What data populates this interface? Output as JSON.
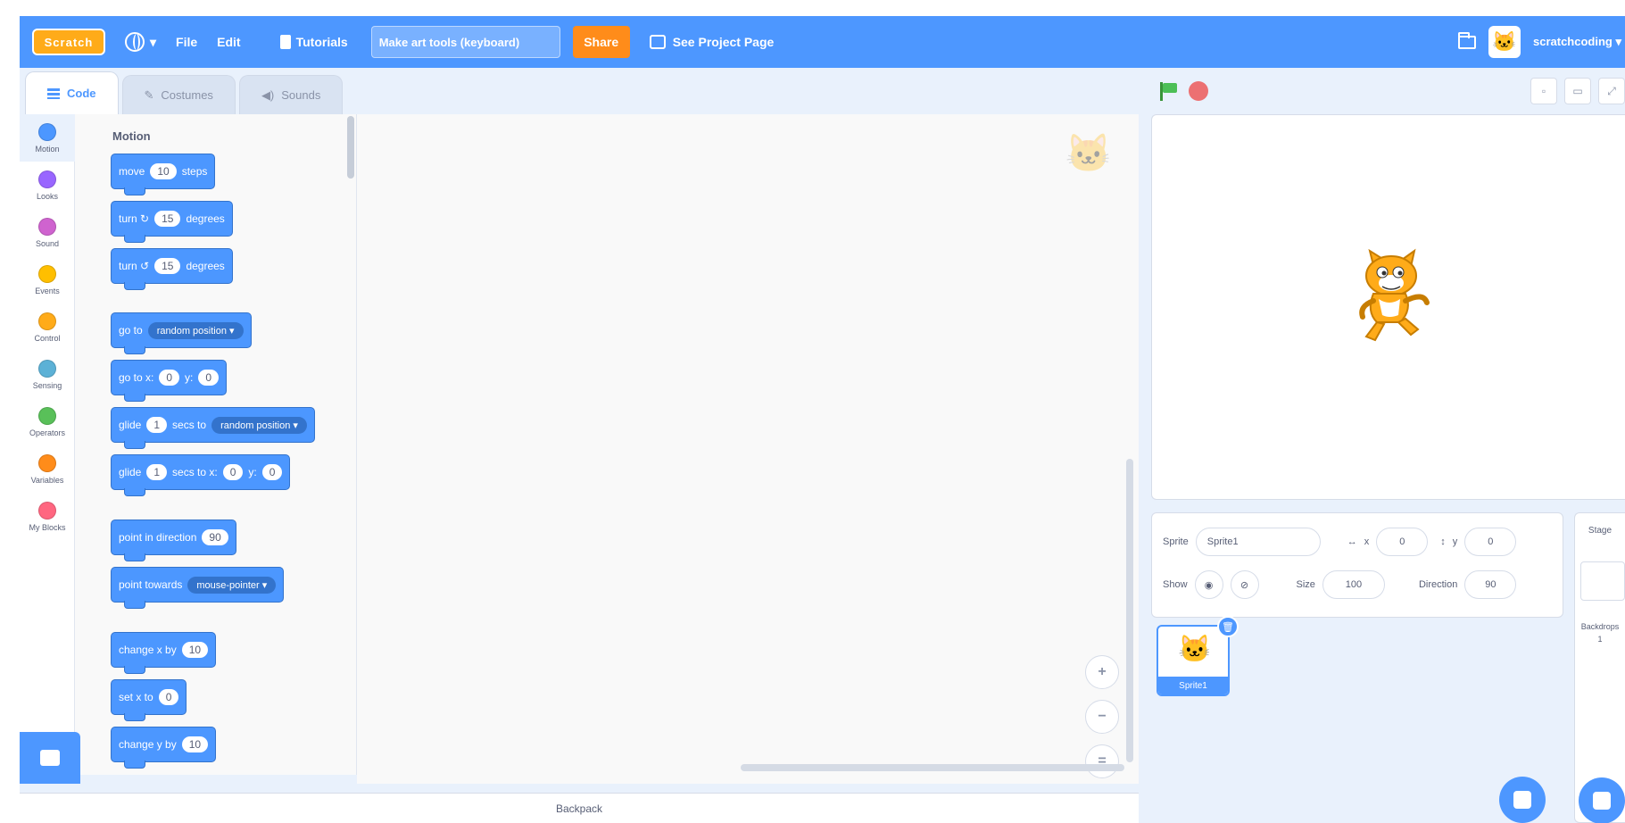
{
  "menubar": {
    "logo": "Scratch",
    "language_icon": "globe-icon",
    "file": "File",
    "edit": "Edit",
    "tutorials": "Tutorials",
    "project_title": "Make art tools (keyboard)",
    "share": "Share",
    "see_project_page": "See Project Page",
    "username": "scratchcoding"
  },
  "tabs": [
    {
      "label": "Code",
      "icon": "code-icon"
    },
    {
      "label": "Costumes",
      "icon": "brush-icon"
    },
    {
      "label": "Sounds",
      "icon": "speaker-icon"
    }
  ],
  "categories": [
    {
      "label": "Motion",
      "color": "#4c97ff"
    },
    {
      "label": "Looks",
      "color": "#9966ff"
    },
    {
      "label": "Sound",
      "color": "#cf63cf"
    },
    {
      "label": "Events",
      "color": "#ffbf00"
    },
    {
      "label": "Control",
      "color": "#ffab19"
    },
    {
      "label": "Sensing",
      "color": "#5cb1d6"
    },
    {
      "label": "Operators",
      "color": "#59c059"
    },
    {
      "label": "Variables",
      "color": "#ff8c1a"
    },
    {
      "label": "My Blocks",
      "color": "#ff6680"
    }
  ],
  "palette": {
    "title": "Motion",
    "blocks": {
      "move": {
        "text": "move",
        "value": "10",
        "suffix": "steps"
      },
      "turn_right": {
        "text": "turn ↻",
        "value": "15",
        "suffix": "degrees"
      },
      "turn_left": {
        "text": "turn ↺",
        "value": "15",
        "suffix": "degrees"
      },
      "goto": {
        "text": "go to",
        "option": "random position ▾"
      },
      "goto_xy": {
        "text": "go to x:",
        "x": "0",
        "ylabel": "y:",
        "y": "0"
      },
      "glide_to": {
        "text": "glide",
        "secs": "1",
        "mid": "secs to",
        "option": "random position ▾"
      },
      "glide_xy": {
        "text": "glide",
        "secs": "1",
        "mid": "secs to x:",
        "x": "0",
        "ylabel": "y:",
        "y": "0"
      },
      "point_dir": {
        "text": "point in direction",
        "value": "90"
      },
      "point_towards": {
        "text": "point towards",
        "option": "mouse-pointer ▾"
      },
      "change_x": {
        "text": "change x by",
        "value": "10"
      },
      "set_x": {
        "text": "set x to",
        "value": "0"
      },
      "change_y": {
        "text": "change y by",
        "value": "10"
      }
    }
  },
  "code_area": {
    "zoom_in": "+",
    "zoom_out": "−",
    "zoom_reset": "="
  },
  "backpack": "Backpack",
  "sprite_info": {
    "sprite_label": "Sprite",
    "sprite_name": "Sprite1",
    "x_label": "x",
    "x_value": "0",
    "y_label": "y",
    "y_value": "0",
    "show_label": "Show",
    "size_label": "Size",
    "size_value": "100",
    "direction_label": "Direction",
    "direction_value": "90"
  },
  "sprites": [
    {
      "name": "Sprite1"
    }
  ],
  "stage_pane": {
    "label": "Stage",
    "backdrops_label": "Backdrops",
    "backdrops_count": "1"
  }
}
